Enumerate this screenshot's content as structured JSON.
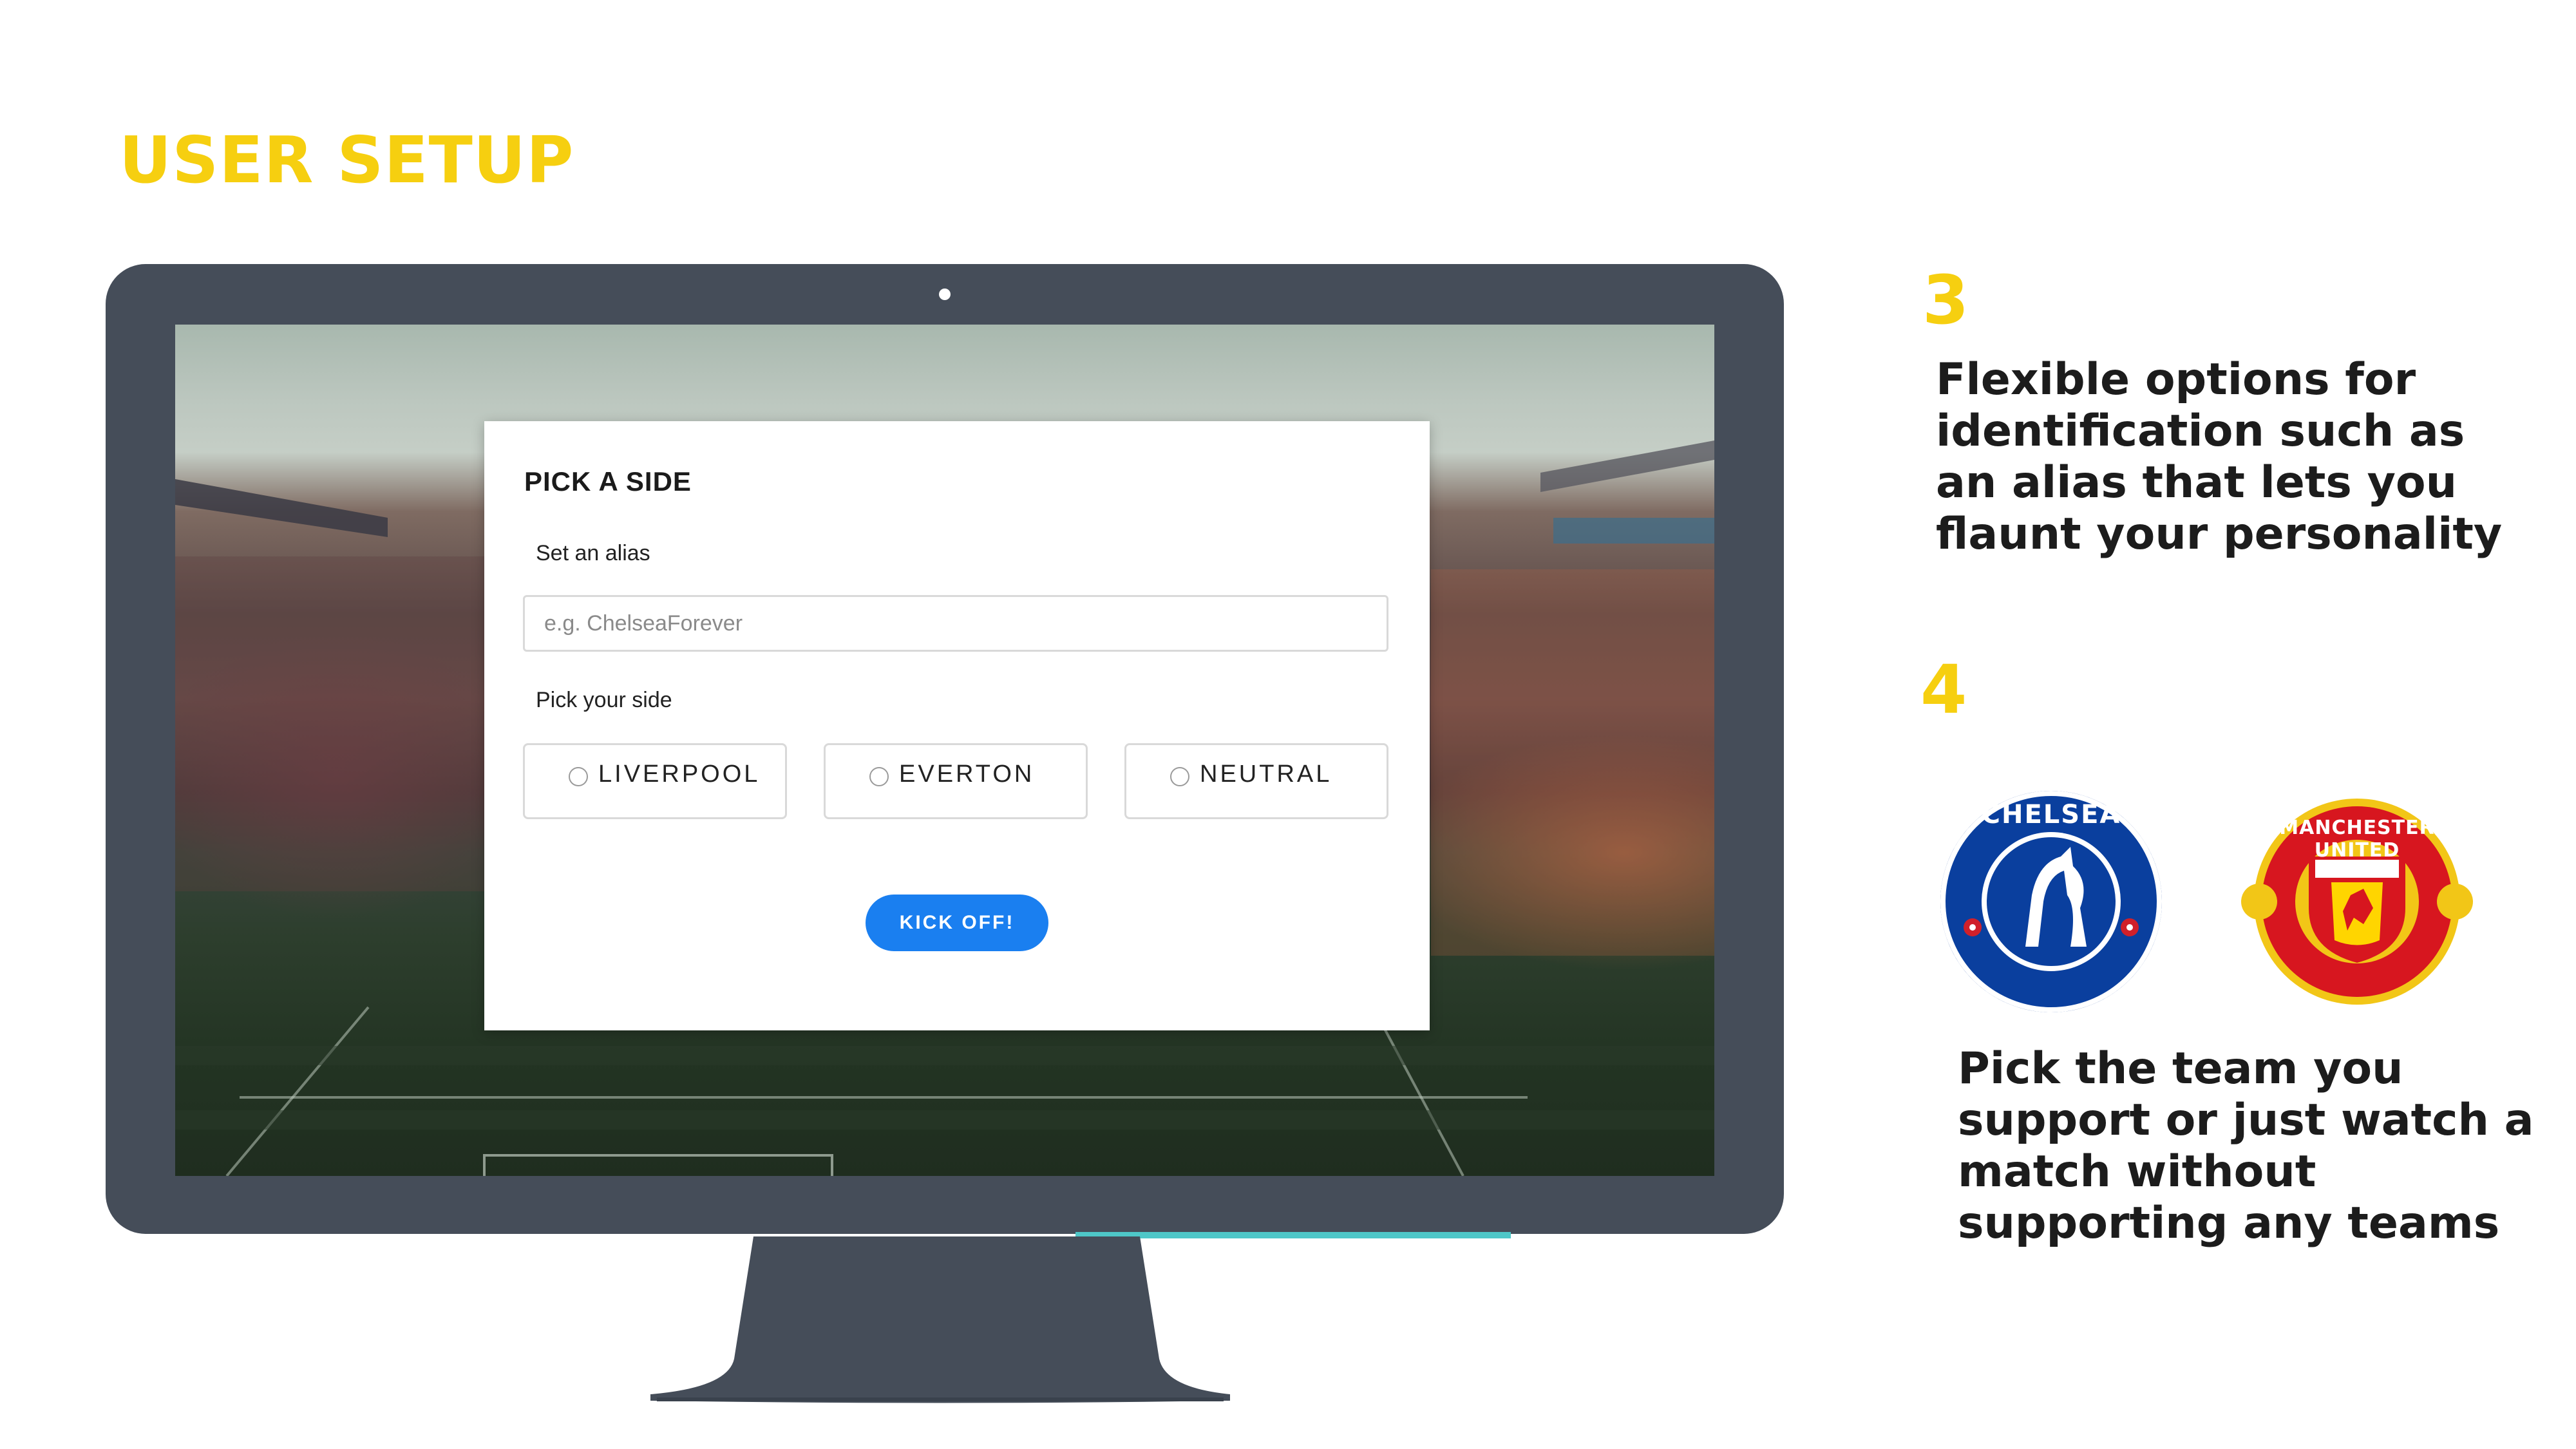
{
  "slide": {
    "title": "USER SETUP"
  },
  "form": {
    "title": "PICK A SIDE",
    "alias_label": "Set an alias",
    "alias_placeholder": "e.g. ChelseaForever",
    "side_label": "Pick your side",
    "options": [
      "LIVERPOOL",
      "EVERTON",
      "NEUTRAL"
    ],
    "submit_label": "KICK OFF!"
  },
  "features": [
    {
      "number": "3",
      "text": "Flexible options for identification such as an alias that lets you flaunt your personality"
    },
    {
      "number": "4",
      "text": "Pick the team you support or just watch a match without supporting any teams"
    }
  ],
  "logos": [
    {
      "name": "chelsea-crest",
      "text": "CHELSEA"
    },
    {
      "name": "manchester-united-crest",
      "text": "MANCHESTER UNITED"
    }
  ],
  "colors": {
    "accent_yellow": "#f6cf10",
    "monitor_frame": "#454d59",
    "button_blue": "#1a7ff0",
    "stand_accent": "#4ec7c8"
  }
}
